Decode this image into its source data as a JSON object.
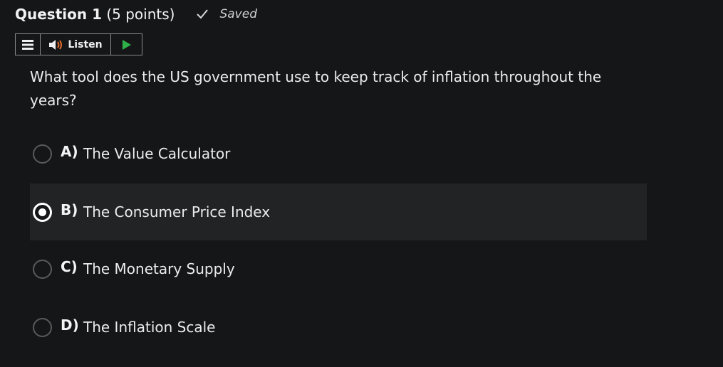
{
  "question": {
    "title": "Question 1",
    "points": "(5 points)",
    "saved_label": "Saved",
    "text": "What tool does the US government use to keep track of inflation throughout the years?"
  },
  "toolbar": {
    "menu_icon": "hamburger-menu-icon",
    "listen_label": "Listen",
    "listen_icon": "speaker-icon",
    "play_icon": "play-icon",
    "play_color": "#2fb14a",
    "speaker_color": "#e06a2a"
  },
  "options": [
    {
      "letter": "A)",
      "text": "The Value Calculator",
      "selected": false
    },
    {
      "letter": "B)",
      "text": "The Consumer Price Index",
      "selected": true
    },
    {
      "letter": "C)",
      "text": "The Monetary Supply",
      "selected": false
    },
    {
      "letter": "D)",
      "text": "The Inflation Scale",
      "selected": false
    }
  ],
  "colors": {
    "background": "#151617",
    "selected_row": "#222324"
  }
}
